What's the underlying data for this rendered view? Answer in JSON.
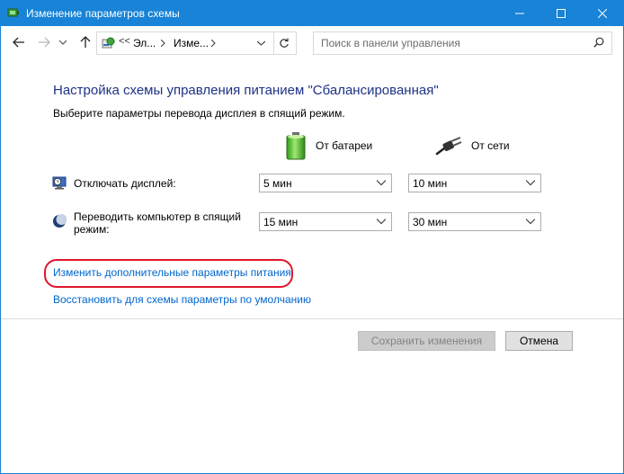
{
  "window": {
    "title": "Изменение параметров схемы"
  },
  "nav": {
    "breadcrumbs": [
      "Эл...",
      "Изме..."
    ],
    "overflow": "<<",
    "search_placeholder": "Поиск в панели управления"
  },
  "content": {
    "heading": "Настройка схемы управления питанием \"Сбалансированная\"",
    "subtitle": "Выберите параметры перевода дисплея в спящий режим.",
    "columns": {
      "battery": "От батареи",
      "plugged": "От сети"
    },
    "rows": [
      {
        "label": "Отключать дисплей:",
        "icon": "display-timer-icon",
        "battery": "5 мин",
        "plugged": "10 мин"
      },
      {
        "label_line1": "Переводить компьютер в спящий",
        "label_line2": "режим:",
        "icon": "sleep-moon-icon",
        "battery": "15 мин",
        "plugged": "30 мин"
      }
    ],
    "link_advanced": "Изменить дополнительные параметры питания",
    "link_restore": "Восстановить для схемы параметры по умолчанию"
  },
  "buttons": {
    "save": "Сохранить изменения",
    "cancel": "Отмена"
  },
  "colors": {
    "titlebar": "#1883d7",
    "heading": "#1e3287",
    "link": "#0066cc",
    "highlight": "#e0162b"
  }
}
